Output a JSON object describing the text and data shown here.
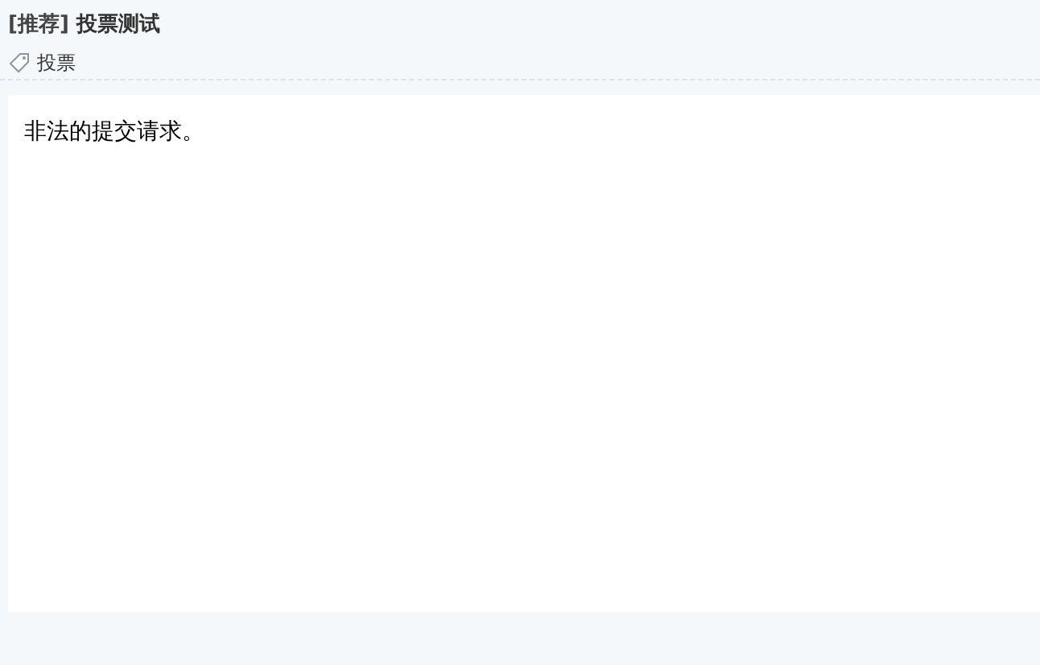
{
  "thread": {
    "category": "[推荐]",
    "title": "投票测试",
    "tags": [
      "投票"
    ]
  },
  "message": "非法的提交请求。"
}
